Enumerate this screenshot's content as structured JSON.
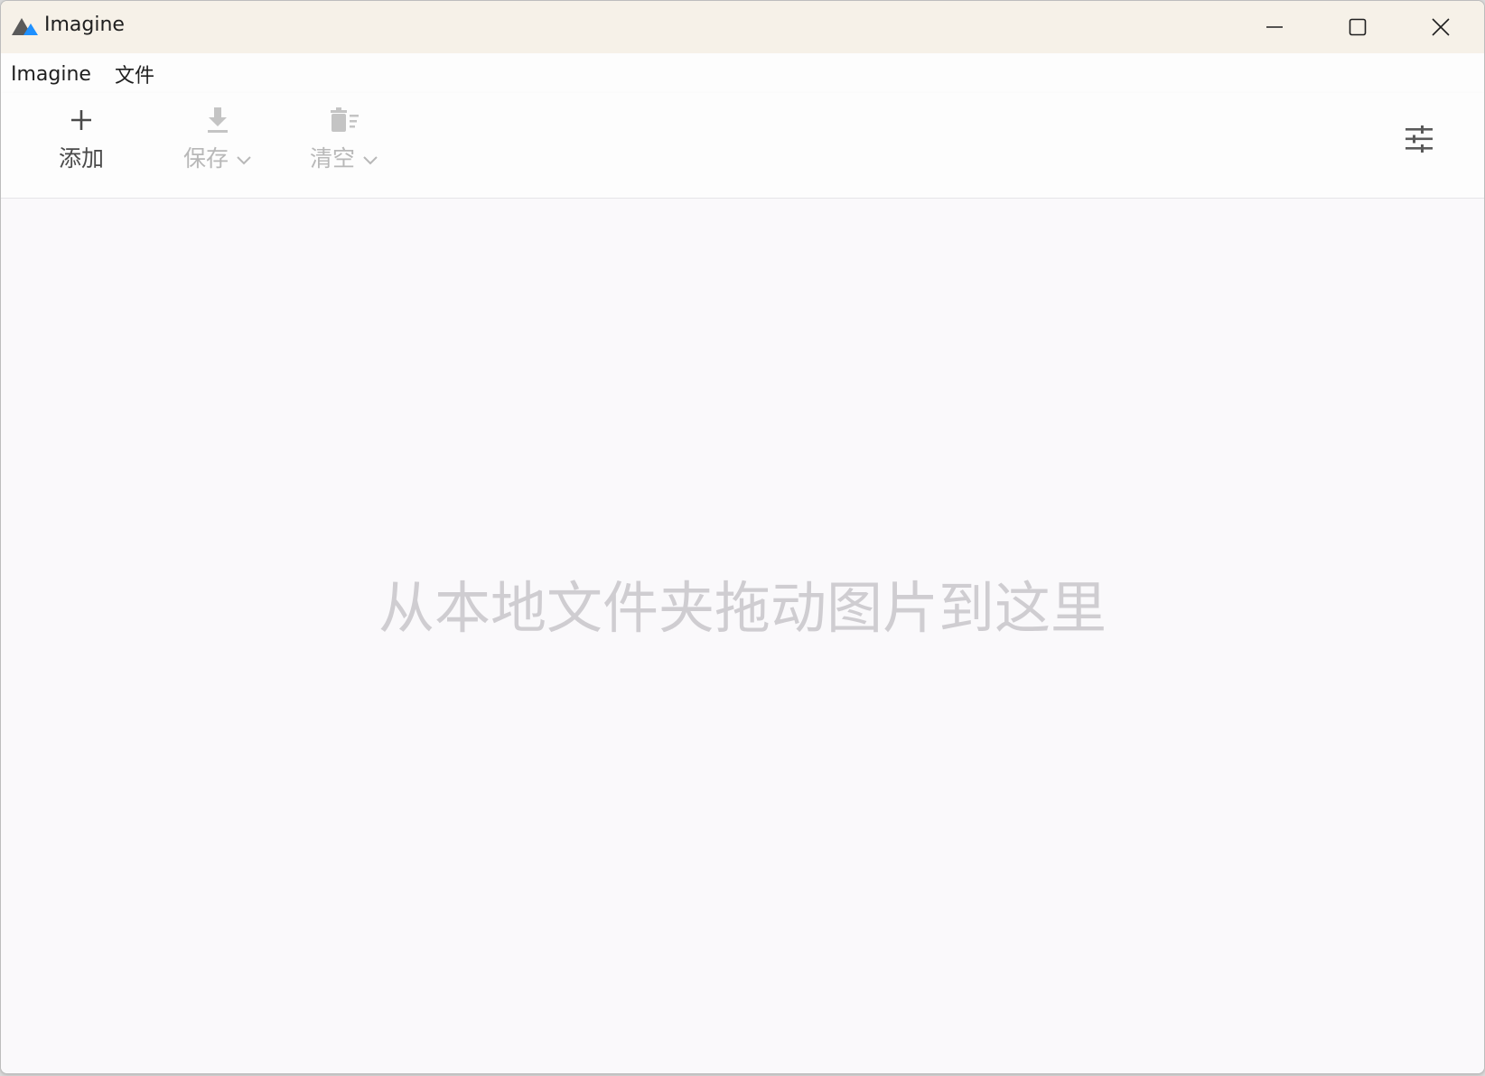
{
  "window": {
    "title": "Imagine"
  },
  "menubar": {
    "items": [
      {
        "label": "Imagine"
      },
      {
        "label": "文件"
      }
    ]
  },
  "toolbar": {
    "add": {
      "label": "添加",
      "icon": "plus-icon",
      "enabled": true
    },
    "save": {
      "label": "保存",
      "icon": "download-icon",
      "enabled": false,
      "has_dropdown": true
    },
    "clear": {
      "label": "清空",
      "icon": "trash-icon",
      "enabled": false,
      "has_dropdown": true
    },
    "settings": {
      "icon": "sliders-icon"
    }
  },
  "main": {
    "drop_hint": "从本地文件夹拖动图片到这里"
  },
  "colors": {
    "titlebar_bg": "#f6f1e8",
    "content_bg": "#faf9fb",
    "logo_dark": "#5a5a5a",
    "logo_accent": "#1e90ff",
    "disabled_text": "#b8b8b8",
    "hint_text": "#cfcdd1"
  }
}
